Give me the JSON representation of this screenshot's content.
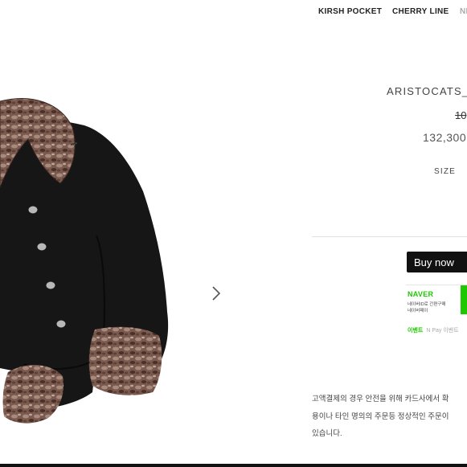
{
  "nav": {
    "items": [
      "KIRSH POCKET",
      "CHERRY LINE",
      "NE"
    ]
  },
  "product": {
    "title": "ARISTOCATS_",
    "price_original": "10",
    "price_sale": "132,300",
    "size_label": "SIZE"
  },
  "actions": {
    "buy_now_label": "Buy now"
  },
  "naver": {
    "logo_text": "NAVER",
    "line1": "네이버ID로 간편구매",
    "line2": "네이버페이"
  },
  "event": {
    "label": "이벤트",
    "text": "N Pay 이벤트"
  },
  "notice": {
    "lines": [
      "고액결제의 경우 안전을 위해 카드사에서 확",
      "용이나 타인 명의의 주문등 정상적인 주문이",
      "있습니다."
    ]
  },
  "colors": {
    "naver_green": "#1ec800",
    "button_bg": "#111111",
    "jacket": "#161616",
    "fur": "#7a5a4e"
  },
  "icons": {
    "next_arrow": "chevron-right-icon"
  }
}
